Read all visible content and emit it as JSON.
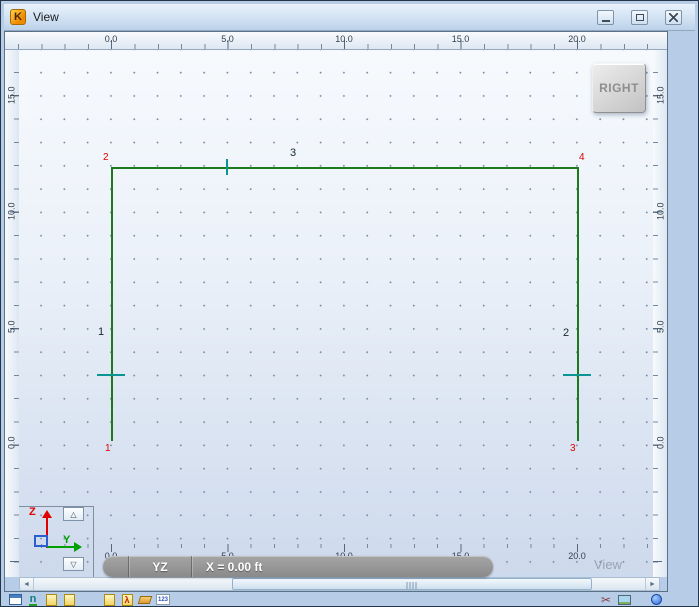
{
  "window": {
    "title": "View",
    "app_icon_letter": "K"
  },
  "rulers": {
    "top": [
      "0.0",
      "5.0",
      "10.0",
      "15.0",
      "20.0"
    ],
    "bottom": [
      "0.0",
      "5.0",
      "10.0",
      "15.0",
      "20.0"
    ],
    "left": [
      "15.0",
      "10.0",
      "5.0",
      "0.0"
    ],
    "right": [
      "15.0",
      "10.0",
      "5.0",
      "0.0"
    ]
  },
  "canvas": {
    "view_button": "RIGHT",
    "watermark": "View",
    "node_labels": [
      "1",
      "2",
      "3",
      "4"
    ],
    "member_labels": [
      "1",
      "2",
      "3"
    ]
  },
  "axis": {
    "z_label": "Z",
    "y_label": "Y",
    "up_glyph": "△",
    "down_glyph": "▽"
  },
  "status": {
    "plane": "YZ",
    "coord": "X = 0.00 ft"
  },
  "scrollbar": {
    "left_glyph": "◄",
    "right_glyph": "►"
  },
  "toolbar": {
    "n_text": "n",
    "numbers_text": "123",
    "lambda_glyph": "λ",
    "cut_glyph": "✂"
  },
  "colors": {
    "member_line": "#1c7a1c",
    "node_label": "#e00000",
    "member_tick": "#0a9494",
    "axis_z": "#e00000",
    "axis_y": "#00a000",
    "axis_plane": "#2b5fd0",
    "frame": "#b7cde7"
  }
}
